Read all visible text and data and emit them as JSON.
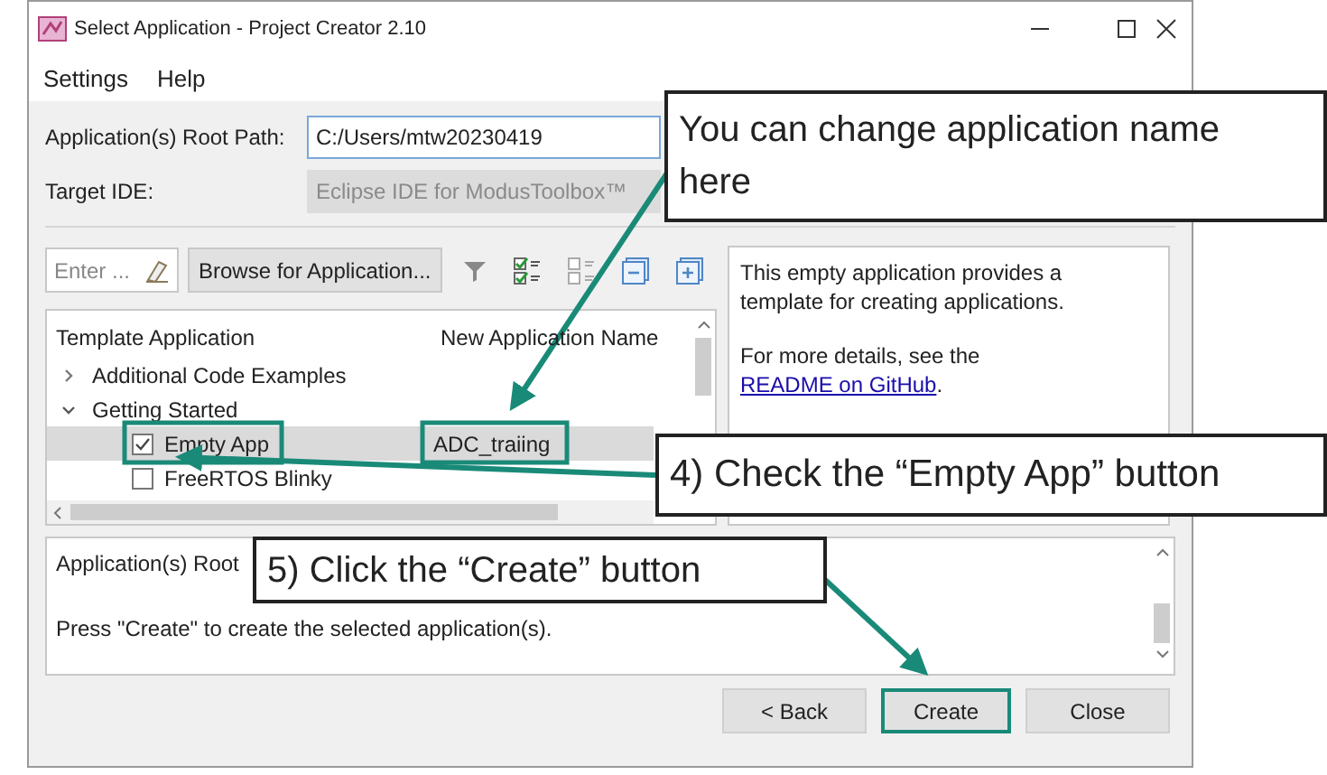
{
  "window": {
    "title": "Select Application - Project Creator 2.10"
  },
  "menu": [
    "Settings",
    "Help"
  ],
  "form": [
    {
      "label": "Application(s) Root Path:",
      "value": "C:/Users/mtw20230419",
      "disabled": false
    },
    {
      "label": "Target IDE:",
      "value": "Eclipse IDE for ModusToolbox™",
      "disabled": true
    }
  ],
  "toolbar": {
    "filter": {
      "placeholder": "Enter ..."
    },
    "browse_button": "Browse for Application..."
  },
  "tree": {
    "columns": [
      "Template Application",
      "New Application Name"
    ],
    "rows": [
      {
        "label": "Additional Code Examples",
        "expanded": false
      },
      {
        "label": "Getting Started",
        "expanded": true,
        "children": [
          {
            "label": "Empty App",
            "checked": true,
            "selected": true,
            "app_name": "ADC_traiing"
          },
          {
            "label": "FreeRTOS Blinky",
            "checked": false,
            "selected": false
          }
        ]
      }
    ]
  },
  "description": {
    "text": "This empty application provides a template for creating applications.",
    "details": "For more details, see the",
    "link": "README on GitHub",
    "end": "."
  },
  "log": [
    "Application(s) Root",
    "Press \"Create\" to create the selected application(s)."
  ],
  "buttons": [
    {
      "label": "< Back",
      "highlighted": false
    },
    {
      "label": "Create",
      "highlighted": true
    },
    {
      "label": "Close",
      "highlighted": false
    }
  ],
  "callouts": [
    "You can change application name here",
    "4) Check the “Empty App” button",
    "5) Click the “Create” button"
  ]
}
